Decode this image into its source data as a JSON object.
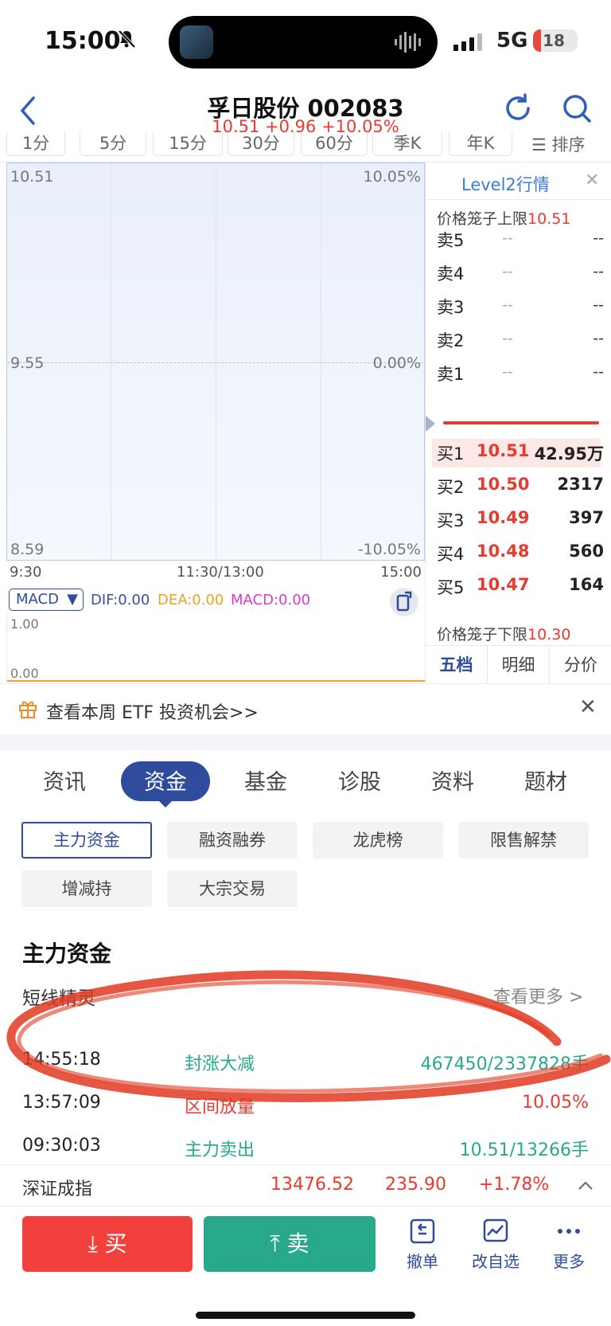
{
  "status_bar": {
    "time": "15:00",
    "network": "5G",
    "battery": "18",
    "battery_level": 0.18
  },
  "header": {
    "title": "孚日股份 002083",
    "quote": "10.51 +0.96 +10.05%"
  },
  "periods": [
    "1分",
    "5分",
    "15分",
    "30分",
    "60分",
    "季K",
    "年K"
  ],
  "periods_sort_label": "排序",
  "chart": {
    "y_top": "10.51",
    "y_mid": "9.55",
    "y_bot": "8.59",
    "pct_top": "10.05%",
    "pct_mid": "0.00%",
    "pct_bot": "-10.05%",
    "x_start": "9:30",
    "x_mid": "11:30/13:00",
    "x_end": "15:00"
  },
  "macd": {
    "selector": "MACD",
    "dif": "DIF:0.00",
    "dea": "DEA:0.00",
    "macd": "MACD:0.00",
    "y_top": "1.00",
    "y_bot": "0.00"
  },
  "orderbook": {
    "title": "Level2行情",
    "upper_limit_label": "价格笼子上限",
    "upper_limit": "10.51",
    "asks": [
      {
        "label": "卖5",
        "price": "--",
        "vol": "--"
      },
      {
        "label": "卖4",
        "price": "--",
        "vol": "--"
      },
      {
        "label": "卖3",
        "price": "--",
        "vol": "--"
      },
      {
        "label": "卖2",
        "price": "--",
        "vol": "--"
      },
      {
        "label": "卖1",
        "price": "--",
        "vol": "--"
      }
    ],
    "bids": [
      {
        "label": "买1",
        "price": "10.51",
        "vol": "42.95万"
      },
      {
        "label": "买2",
        "price": "10.50",
        "vol": "2317"
      },
      {
        "label": "买3",
        "price": "10.49",
        "vol": "397"
      },
      {
        "label": "买4",
        "price": "10.48",
        "vol": "560"
      },
      {
        "label": "买5",
        "price": "10.47",
        "vol": "164"
      }
    ],
    "lower_limit_label": "价格笼子下限",
    "lower_limit": "10.30",
    "tabs": [
      "五档",
      "明细",
      "分价"
    ]
  },
  "promo": {
    "text": "查看本周 ETF 投资机会>>"
  },
  "tabs": [
    "资讯",
    "资金",
    "基金",
    "诊股",
    "资料",
    "题材"
  ],
  "chips": [
    "主力资金",
    "融资融券",
    "龙虎榜",
    "限售解禁",
    "增减持",
    "大宗交易"
  ],
  "fund": {
    "title": "主力资金",
    "subtitle": "短线精灵",
    "more": "查看更多 >",
    "rows": [
      {
        "time": "14:55:18",
        "type": "封涨大减",
        "value": "467450/2337828手",
        "color": "#29a98b"
      },
      {
        "time": "13:57:09",
        "type": "区间放量",
        "value": "10.05%",
        "color": "#e83a2f"
      },
      {
        "time": "09:30:03",
        "type": "主力卖出",
        "value": "10.51/13266手",
        "color": "#29a98b"
      }
    ]
  },
  "index": {
    "name": "深证成指",
    "value": "13476.52",
    "change": "235.90",
    "pct": "+1.78%"
  },
  "bottom": {
    "buy": "买",
    "sell": "卖",
    "cancel": "撤单",
    "watch": "改自选",
    "more": "更多"
  }
}
